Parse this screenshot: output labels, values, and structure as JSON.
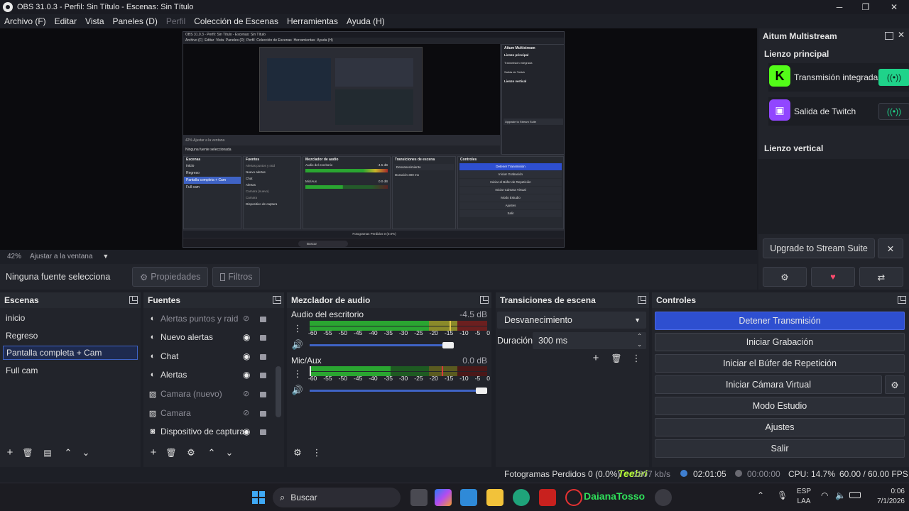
{
  "window": {
    "title": "OBS 31.0.3 - Perfil: Sin Título - Escenas: Sin Título",
    "minimize": "─",
    "maximize": "❐",
    "close": "✕"
  },
  "menu": [
    "Archivo (F)",
    "Editar",
    "Vista",
    "Paneles (D)",
    "Perfil",
    "Colección de Escenas",
    "Herramientas",
    "Ayuda (H)"
  ],
  "preview": {
    "zoom": "42%",
    "fit_label": "Ajustar a la ventana",
    "nested_screenshot": {
      "title": "OBS 31.0.3 - Perfil: Sin Título - Escenas: Sin Título",
      "menu": [
        "Archivo (F)",
        "Editar",
        "Vista",
        "Paneles (D)",
        "Perfil",
        "Colección de Escenas",
        "Herramientas",
        "Ayuda (H)"
      ],
      "no_source": "Ninguna fuente seleccionada",
      "scenes_header": "Escenas",
      "scenes": [
        "inicio",
        "Regreso",
        "Pantalla completa + Cam",
        "Full cam"
      ],
      "sources_header": "Fuentes",
      "sources": [
        "Alertas puntos y raid",
        "Nuevo alertas",
        "Chat",
        "Alertas",
        "Camara (nuevo)",
        "Camara",
        "Dispositivo de captura"
      ],
      "mixer_header": "Mezclador de audio",
      "mixer_tracks": [
        {
          "name": "Audio del escritorio",
          "level": "-4.5 dB"
        },
        {
          "name": "Mic/Aux",
          "level": "0.0 dB"
        }
      ],
      "transitions_header": "Transiciones de escena",
      "transition": "Desvanecimiento",
      "duration": "Duración",
      "duration_value": "300 ms",
      "controls_header": "Controles",
      "controls": [
        "Detener Transmisión",
        "Iniciar Grabación",
        "Iniciar el Búfer de Repetición",
        "Iniciar Cámara Virtual",
        "Modo Estudio",
        "Ajustes",
        "Salir"
      ],
      "dock_title": "Aitum Multistream",
      "dock_main": "Lienzo principal",
      "dock_outputs": [
        "Transmisión integrada",
        "Salida de Twitch"
      ],
      "dock_vertical": "Lienzo vertical",
      "dock_upgrade": "Upgrade to Stream Suite",
      "status": "Fotogramas Perdidos 0 (0.0%)",
      "search": "Buscar"
    }
  },
  "source_toolbar": {
    "no_selection": "Ninguna fuente selecciona",
    "properties": "Propiedades",
    "filters": "Filtros"
  },
  "multistream": {
    "title": "Aitum Multistream",
    "main_canvas": "Lienzo principal",
    "outputs": [
      {
        "name": "Transmisión integrada",
        "logo": "K",
        "logo_color": "#53fc18",
        "active": true
      },
      {
        "name": "Salida de Twitch",
        "logo": "twitch-icon",
        "logo_color": "#9146ff",
        "active": false
      }
    ],
    "vertical_canvas": "Lienzo vertical",
    "upgrade": "Upgrade to Stream Suite",
    "close": "✕",
    "settings_icon": "gear-icon",
    "heart_icon": "heart-icon",
    "share_icon": "share-icon"
  },
  "scenes": {
    "title": "Escenas",
    "items": [
      "inicio",
      "Regreso",
      "Pantalla completa + Cam",
      "Full cam"
    ],
    "selected_index": 2
  },
  "sources": {
    "title": "Fuentes",
    "items": [
      {
        "name": "Alertas puntos y raid",
        "icon": "browser-icon",
        "visible": false
      },
      {
        "name": "Nuevo alertas",
        "icon": "browser-icon",
        "visible": true
      },
      {
        "name": "Chat",
        "icon": "browser-icon",
        "visible": true
      },
      {
        "name": "Alertas",
        "icon": "browser-icon",
        "visible": true
      },
      {
        "name": "Camara (nuevo)",
        "icon": "image-icon",
        "visible": false
      },
      {
        "name": "Camara",
        "icon": "image-icon",
        "visible": false
      },
      {
        "name": "Dispositivo de captura",
        "icon": "camera-icon",
        "visible": true
      }
    ]
  },
  "mixer": {
    "title": "Mezclador de audio",
    "tracks": [
      {
        "name": "Audio del escritorio",
        "level": "-4.5 dB",
        "volume": 0.96
      },
      {
        "name": "Mic/Aux",
        "level": "0.0 dB",
        "volume": 1.0
      }
    ],
    "ticks": [
      "-60",
      "-55",
      "-50",
      "-45",
      "-40",
      "-35",
      "-30",
      "-25",
      "-20",
      "-15",
      "-10",
      "-5",
      "0"
    ]
  },
  "transitions": {
    "title": "Transiciones de escena",
    "selected": "Desvanecimiento",
    "duration_label": "Duración",
    "duration_value": "300 ms"
  },
  "controls": {
    "title": "Controles",
    "buttons": [
      "Detener Transmisión",
      "Iniciar Grabación",
      "Iniciar el Búfer de Repetición",
      "Iniciar Cámara Virtual",
      "Modo Estudio",
      "Ajustes",
      "Salir"
    ]
  },
  "statusbar": {
    "dropped": "Fotogramas Perdidos 0 (0.0%)",
    "bitrate": "1807 kb/s",
    "stream_time": "02:01:05",
    "rec_time": "00:00:00",
    "cpu": "CPU: 14.7%",
    "fps": "60.00 / 60.00 FPS",
    "overlay_text": "Teebri"
  },
  "taskbar": {
    "search": "Buscar",
    "overlay_name": "DaianaTosso",
    "lang_top": "ESP",
    "lang_bottom": "LAA",
    "time": "0:06",
    "date": "7/1/2026"
  },
  "colors": {
    "accent": "#2e4fd0",
    "live": "#1fd38a",
    "selected_scene_border": "#3f63c5"
  }
}
